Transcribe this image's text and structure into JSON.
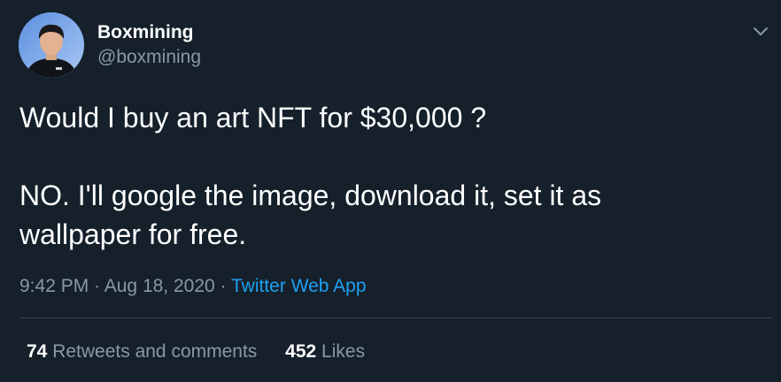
{
  "author": {
    "display_name": "Boxmining",
    "handle": "@boxmining"
  },
  "tweet": {
    "lines": [
      "Would I buy an art NFT for $30,000 ?",
      "",
      "NO. I'll google the image, download it, set it as",
      "wallpaper for free."
    ]
  },
  "meta": {
    "time": "9:42 PM",
    "separator": "·",
    "date": "Aug 18, 2020",
    "source": "Twitter Web App"
  },
  "stats": {
    "retweets_count": "74",
    "retweets_label": "Retweets and comments",
    "likes_count": "452",
    "likes_label": "Likes"
  },
  "icons": {
    "menu": "chevron-down-icon"
  },
  "colors": {
    "background": "#15202b",
    "primary_text": "#ffffff",
    "secondary_text": "#8899a6",
    "accent": "#1da1f2",
    "divider": "#38444d"
  }
}
